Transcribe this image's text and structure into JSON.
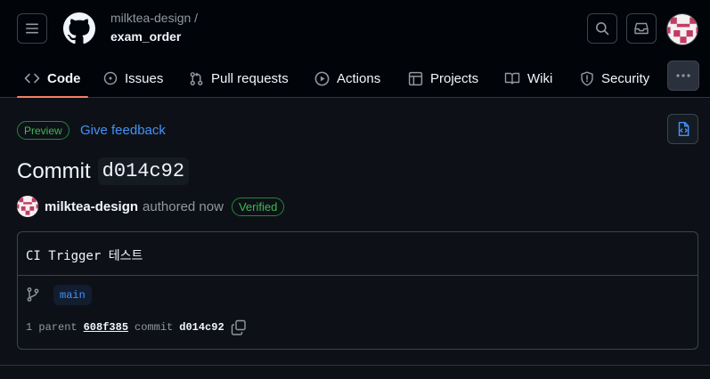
{
  "header": {
    "owner": "milktea-design /",
    "repo": "exam_order",
    "icons": [
      "hamburger-icon",
      "github-logo-icon",
      "search-icon",
      "inbox-icon",
      "avatar"
    ]
  },
  "tabs": [
    {
      "label": "Code",
      "icon": "code-icon",
      "active": true
    },
    {
      "label": "Issues",
      "icon": "issue-icon"
    },
    {
      "label": "Pull requests",
      "icon": "pull-request-icon"
    },
    {
      "label": "Actions",
      "icon": "play-icon"
    },
    {
      "label": "Projects",
      "icon": "table-icon"
    },
    {
      "label": "Wiki",
      "icon": "book-icon"
    },
    {
      "label": "Security",
      "icon": "shield-icon"
    }
  ],
  "banner": {
    "preview_label": "Preview",
    "feedback_label": "Give feedback"
  },
  "commit": {
    "title_prefix": "Commit",
    "short_sha": "d014c92",
    "author": "milktea-design",
    "authored_text": "authored now",
    "verified_label": "Verified",
    "message": "CI Trigger 테스트",
    "branch": "main",
    "parent_count_label": "1 parent",
    "parent_sha": "608f385",
    "commit_label": "commit",
    "commit_sha": "d014c92"
  },
  "colors": {
    "background": "#0d1117",
    "header_bg": "#010409",
    "accent_underline": "#f78166",
    "link": "#4493f8",
    "success": "#3fb950"
  }
}
